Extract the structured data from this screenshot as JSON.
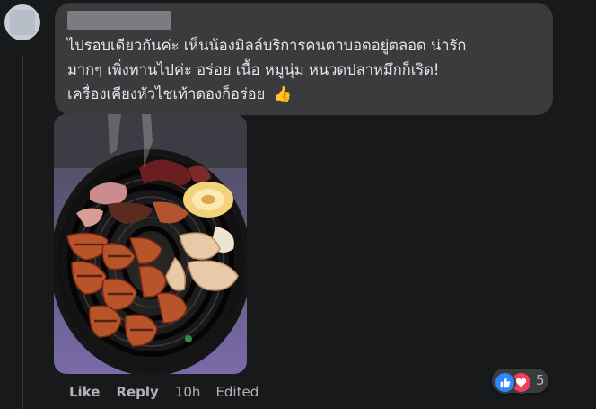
{
  "comment": {
    "author": "",
    "text_lines": [
      "ไปรอบเดียวกันค่ะ เห็นน้องมิลล์บริการคนตาบอดอยู่ตลอด น่ารัก",
      "มากๆ เพิ่งทานไปค่ะ อร่อย เนื้อ หมูนุ่ม หนวดปลาหมึกก็เริด!",
      "เครื่องเคียงหัวไชเท้าดองก็อร่อย"
    ],
    "emoji": "👍",
    "photo_icon": "grilled-meat-photo"
  },
  "actions": {
    "like_label": "Like",
    "reply_label": "Reply",
    "timestamp": "10h",
    "edited_label": "Edited"
  },
  "reactions": {
    "icons": [
      "like-reaction-icon",
      "love-reaction-icon"
    ],
    "count": "5"
  },
  "colors": {
    "background": "#18191a",
    "bubble": "#3a3b3c",
    "text": "#e4e6eb",
    "secondary_text": "#b0b3b8",
    "like_blue": "#2d88ff",
    "love_red": "#f33e58"
  }
}
